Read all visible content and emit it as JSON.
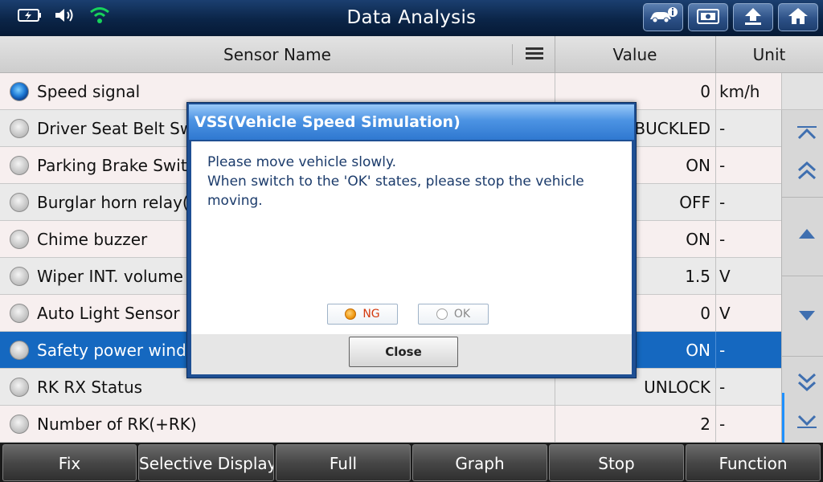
{
  "header": {
    "title": "Data Analysis",
    "status_icons": [
      "battery-icon",
      "speaker-icon",
      "wifi-icon"
    ],
    "toolbar_icons": [
      "vehicle-info-icon",
      "screenshot-icon",
      "upload-icon",
      "home-icon"
    ]
  },
  "table": {
    "columns": {
      "sensor_name": "Sensor Name",
      "value": "Value",
      "unit": "Unit"
    },
    "rows": [
      {
        "name": "Speed signal",
        "value": "0",
        "unit": "km/h"
      },
      {
        "name": "Driver Seat Belt Sw",
        "value": "BUCKLED",
        "unit": "-"
      },
      {
        "name": "Parking Brake Swit",
        "value": "ON",
        "unit": "-"
      },
      {
        "name": "Burglar horn relay(",
        "value": "OFF",
        "unit": "-"
      },
      {
        "name": "Chime buzzer",
        "value": "ON",
        "unit": "-"
      },
      {
        "name": "Wiper INT. volume",
        "value": "1.5",
        "unit": "V"
      },
      {
        "name": "Auto Light Sensor",
        "value": "0",
        "unit": "V"
      },
      {
        "name": "Safety power windo",
        "value": "ON",
        "unit": "-"
      },
      {
        "name": "RK RX Status",
        "value": "UNLOCK",
        "unit": "-"
      },
      {
        "name": "Number of RK(+RK)",
        "value": "2",
        "unit": "-"
      }
    ],
    "selected_index": 7
  },
  "dialog": {
    "title": "VSS(Vehicle Speed Simulation)",
    "line1": "Please move vehicle slowly.",
    "line2": "When switch to the 'OK' states, please stop the vehicle moving.",
    "ng_label": "NG",
    "ok_label": "OK",
    "close_label": "Close"
  },
  "bottom_buttons": [
    "Fix",
    "Selective Display",
    "Full",
    "Graph",
    "Stop",
    "Function"
  ],
  "colors": {
    "accent": "#1568c0",
    "header_bg": "#0b2548",
    "dialog_title": "#3a83d8"
  }
}
